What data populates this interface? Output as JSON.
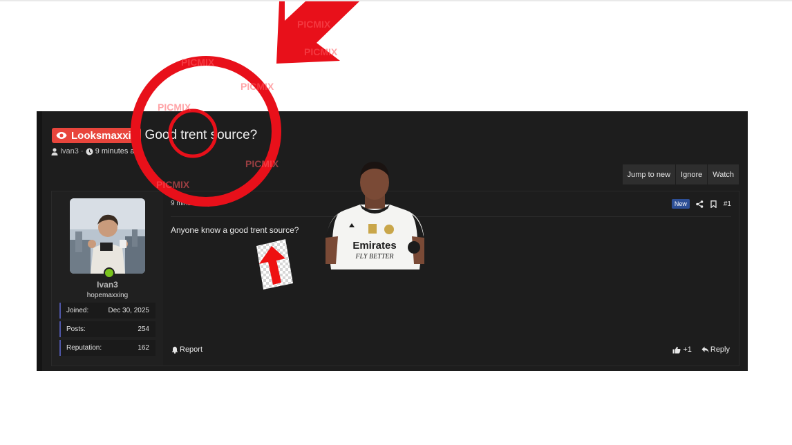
{
  "thread": {
    "prefix": "Looksmaxxir",
    "title": "Good trent source?",
    "author": "Ivan3",
    "time_ago": "9 minutes ag"
  },
  "actions": [
    "Jump to new",
    "Ignore",
    "Watch"
  ],
  "post": {
    "time": "9 minutes ago",
    "badge": "New",
    "number": "#1",
    "text": "Anyone know a good trent source?",
    "report_label": "Report",
    "reaction_count": "+1",
    "reply_label": "Reply"
  },
  "user": {
    "name": "Ivan3",
    "title": "hopemaxxing",
    "stats": [
      {
        "label": "Joined:",
        "value": "Dec 30, 2025"
      },
      {
        "label": "Posts:",
        "value": "254"
      },
      {
        "label": "Reputation:",
        "value": "162"
      }
    ]
  },
  "overlay": {
    "watermark": "PICMIX",
    "sticker_text_line1": "Emirates",
    "sticker_text_line2": "FLY BETTER"
  },
  "colors": {
    "prefix_bg": "#e8453c",
    "overlay_red": "#e8101a",
    "online": "#79c31d",
    "new_badge": "#2d4f96",
    "stat_accent": "#4f56a8"
  },
  "icons": [
    "eye-icon",
    "user-icon",
    "clock-icon",
    "share-icon",
    "bookmark-icon",
    "bell-icon",
    "thumbs-up-icon",
    "reply-icon"
  ]
}
